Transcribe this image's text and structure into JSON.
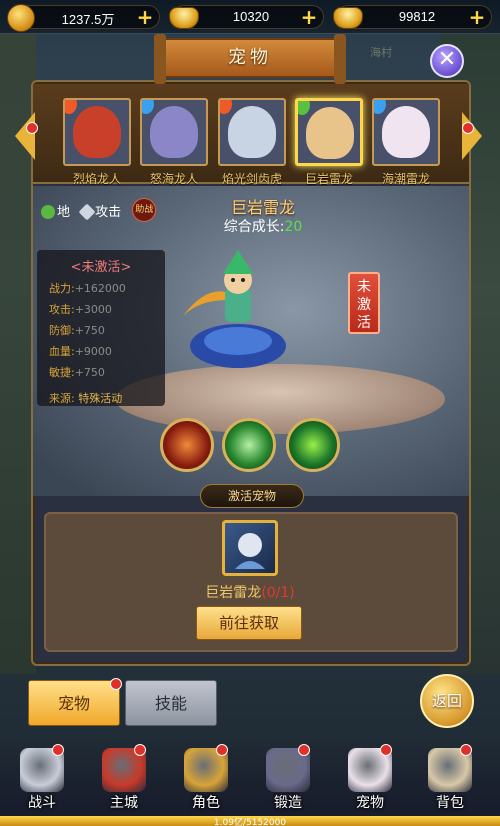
{
  "currency": [
    {
      "value": "1237.5万",
      "icon": "gold-coin-icon"
    },
    {
      "value": "10320",
      "icon": "locked-ingot-icon"
    },
    {
      "value": "99812",
      "icon": "gold-ingot-icon"
    }
  ],
  "panel": {
    "title": "宠物",
    "side_tag": "海村"
  },
  "pets": [
    {
      "name": "烈焰龙人",
      "element": "fire",
      "elem_color": "#f05a2a",
      "face_color": "#c8402a"
    },
    {
      "name": "怒海龙人",
      "element": "water",
      "elem_color": "#3aa0f0",
      "face_color": "#8a86c8"
    },
    {
      "name": "焰光剑齿虎",
      "element": "fire",
      "elem_color": "#f05a2a",
      "face_color": "#c8d4e4"
    },
    {
      "name": "巨岩雷龙",
      "element": "earth",
      "elem_color": "#5ac040",
      "face_color": "#e8c48a",
      "active": true
    },
    {
      "name": "海潮雷龙",
      "element": "water",
      "elem_color": "#3aa0f0",
      "face_color": "#f0e4f0"
    }
  ],
  "selected": {
    "badge_element": "地",
    "badge_type": "攻击",
    "badge_assist": "助战",
    "name": "巨岩雷龙",
    "growth_label": "综合成长:",
    "growth_value": "20",
    "status_title": "<未激活>",
    "stats": [
      {
        "label": "战力:",
        "value": "+162000"
      },
      {
        "label": "攻击:",
        "value": "+3000"
      },
      {
        "label": "防御:",
        "value": "+750"
      },
      {
        "label": "血量:",
        "value": "+9000"
      },
      {
        "label": "敏捷:",
        "value": "+750"
      }
    ],
    "source_label": "来源:",
    "source_value": "特殊活动",
    "inactive_tag": "未激活"
  },
  "skills": [
    "fire-skill-icon",
    "wind-skill-icon",
    "poison-skill-icon"
  ],
  "activate": {
    "header": "激活宠物",
    "fragment_name": "巨岩雷龙",
    "fragment_count": "(0/1)",
    "button": "前往获取"
  },
  "tabs": {
    "pet": "宠物",
    "skill": "技能",
    "back": "返回"
  },
  "nav": [
    {
      "label": "战斗",
      "icon": "battle-icon",
      "color": "#c8cdd8"
    },
    {
      "label": "主城",
      "icon": "city-icon",
      "color": "#c83a2a"
    },
    {
      "label": "角色",
      "icon": "helmet-icon",
      "color": "#d8a43a"
    },
    {
      "label": "锻造",
      "icon": "anvil-icon",
      "color": "#6a6a8a"
    },
    {
      "label": "宠物",
      "icon": "pet-icon",
      "color": "#eae0e8"
    },
    {
      "label": "背包",
      "icon": "bag-icon",
      "color": "#d8c8a8"
    }
  ],
  "exp": {
    "text": "1.09亿/5152000",
    "fill": 1.0
  }
}
